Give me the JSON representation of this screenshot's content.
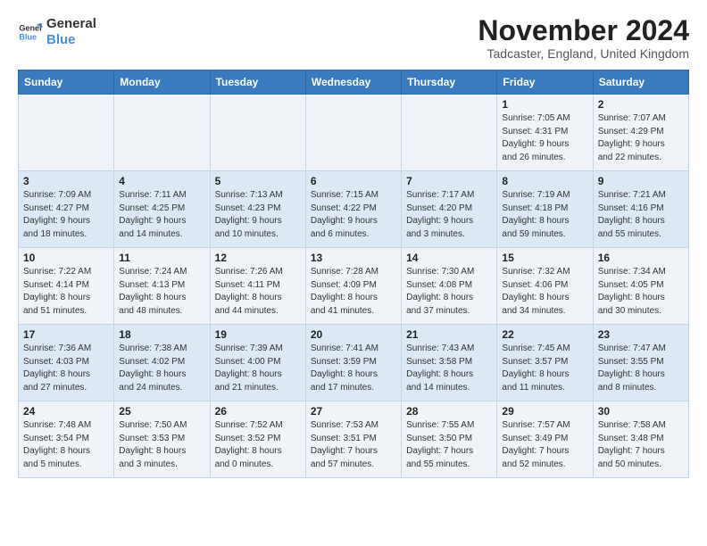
{
  "logo": {
    "line1": "General",
    "line2": "Blue"
  },
  "title": "November 2024",
  "location": "Tadcaster, England, United Kingdom",
  "days_of_week": [
    "Sunday",
    "Monday",
    "Tuesday",
    "Wednesday",
    "Thursday",
    "Friday",
    "Saturday"
  ],
  "weeks": [
    [
      {
        "day": "",
        "info": ""
      },
      {
        "day": "",
        "info": ""
      },
      {
        "day": "",
        "info": ""
      },
      {
        "day": "",
        "info": ""
      },
      {
        "day": "",
        "info": ""
      },
      {
        "day": "1",
        "info": "Sunrise: 7:05 AM\nSunset: 4:31 PM\nDaylight: 9 hours\nand 26 minutes."
      },
      {
        "day": "2",
        "info": "Sunrise: 7:07 AM\nSunset: 4:29 PM\nDaylight: 9 hours\nand 22 minutes."
      }
    ],
    [
      {
        "day": "3",
        "info": "Sunrise: 7:09 AM\nSunset: 4:27 PM\nDaylight: 9 hours\nand 18 minutes."
      },
      {
        "day": "4",
        "info": "Sunrise: 7:11 AM\nSunset: 4:25 PM\nDaylight: 9 hours\nand 14 minutes."
      },
      {
        "day": "5",
        "info": "Sunrise: 7:13 AM\nSunset: 4:23 PM\nDaylight: 9 hours\nand 10 minutes."
      },
      {
        "day": "6",
        "info": "Sunrise: 7:15 AM\nSunset: 4:22 PM\nDaylight: 9 hours\nand 6 minutes."
      },
      {
        "day": "7",
        "info": "Sunrise: 7:17 AM\nSunset: 4:20 PM\nDaylight: 9 hours\nand 3 minutes."
      },
      {
        "day": "8",
        "info": "Sunrise: 7:19 AM\nSunset: 4:18 PM\nDaylight: 8 hours\nand 59 minutes."
      },
      {
        "day": "9",
        "info": "Sunrise: 7:21 AM\nSunset: 4:16 PM\nDaylight: 8 hours\nand 55 minutes."
      }
    ],
    [
      {
        "day": "10",
        "info": "Sunrise: 7:22 AM\nSunset: 4:14 PM\nDaylight: 8 hours\nand 51 minutes."
      },
      {
        "day": "11",
        "info": "Sunrise: 7:24 AM\nSunset: 4:13 PM\nDaylight: 8 hours\nand 48 minutes."
      },
      {
        "day": "12",
        "info": "Sunrise: 7:26 AM\nSunset: 4:11 PM\nDaylight: 8 hours\nand 44 minutes."
      },
      {
        "day": "13",
        "info": "Sunrise: 7:28 AM\nSunset: 4:09 PM\nDaylight: 8 hours\nand 41 minutes."
      },
      {
        "day": "14",
        "info": "Sunrise: 7:30 AM\nSunset: 4:08 PM\nDaylight: 8 hours\nand 37 minutes."
      },
      {
        "day": "15",
        "info": "Sunrise: 7:32 AM\nSunset: 4:06 PM\nDaylight: 8 hours\nand 34 minutes."
      },
      {
        "day": "16",
        "info": "Sunrise: 7:34 AM\nSunset: 4:05 PM\nDaylight: 8 hours\nand 30 minutes."
      }
    ],
    [
      {
        "day": "17",
        "info": "Sunrise: 7:36 AM\nSunset: 4:03 PM\nDaylight: 8 hours\nand 27 minutes."
      },
      {
        "day": "18",
        "info": "Sunrise: 7:38 AM\nSunset: 4:02 PM\nDaylight: 8 hours\nand 24 minutes."
      },
      {
        "day": "19",
        "info": "Sunrise: 7:39 AM\nSunset: 4:00 PM\nDaylight: 8 hours\nand 21 minutes."
      },
      {
        "day": "20",
        "info": "Sunrise: 7:41 AM\nSunset: 3:59 PM\nDaylight: 8 hours\nand 17 minutes."
      },
      {
        "day": "21",
        "info": "Sunrise: 7:43 AM\nSunset: 3:58 PM\nDaylight: 8 hours\nand 14 minutes."
      },
      {
        "day": "22",
        "info": "Sunrise: 7:45 AM\nSunset: 3:57 PM\nDaylight: 8 hours\nand 11 minutes."
      },
      {
        "day": "23",
        "info": "Sunrise: 7:47 AM\nSunset: 3:55 PM\nDaylight: 8 hours\nand 8 minutes."
      }
    ],
    [
      {
        "day": "24",
        "info": "Sunrise: 7:48 AM\nSunset: 3:54 PM\nDaylight: 8 hours\nand 5 minutes."
      },
      {
        "day": "25",
        "info": "Sunrise: 7:50 AM\nSunset: 3:53 PM\nDaylight: 8 hours\nand 3 minutes."
      },
      {
        "day": "26",
        "info": "Sunrise: 7:52 AM\nSunset: 3:52 PM\nDaylight: 8 hours\nand 0 minutes."
      },
      {
        "day": "27",
        "info": "Sunrise: 7:53 AM\nSunset: 3:51 PM\nDaylight: 7 hours\nand 57 minutes."
      },
      {
        "day": "28",
        "info": "Sunrise: 7:55 AM\nSunset: 3:50 PM\nDaylight: 7 hours\nand 55 minutes."
      },
      {
        "day": "29",
        "info": "Sunrise: 7:57 AM\nSunset: 3:49 PM\nDaylight: 7 hours\nand 52 minutes."
      },
      {
        "day": "30",
        "info": "Sunrise: 7:58 AM\nSunset: 3:48 PM\nDaylight: 7 hours\nand 50 minutes."
      }
    ]
  ]
}
